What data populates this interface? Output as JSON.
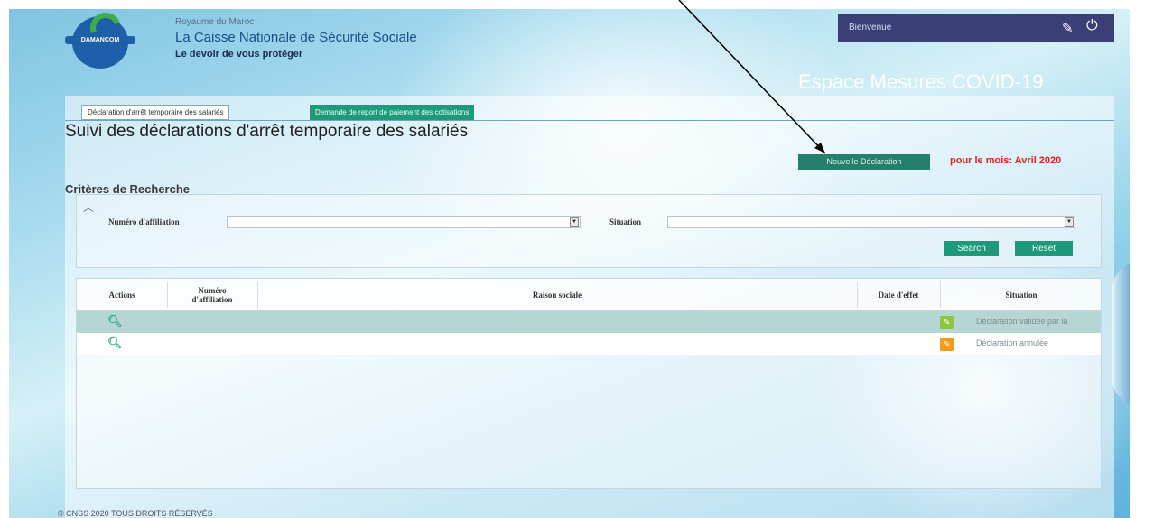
{
  "header": {
    "logo_text": "DAMANCOM",
    "kingdom": "Royaume du Maroc",
    "org_name": "La Caisse Nationale de Sécurité Sociale",
    "tagline": "Le devoir de vous protéger",
    "welcome": "Bienvenue",
    "edit_icon": "pencil-icon",
    "power_icon": "power-icon",
    "space_title": "Espace Mesures COVID-19"
  },
  "tabs": [
    {
      "label": "Déclaration d'arrêt temporaire des salariés",
      "active": true
    },
    {
      "label": "Demande de report de paiement des cotisations",
      "active": false
    }
  ],
  "page_title": "Suivi des déclarations d'arrêt temporaire des salariés",
  "new_declaration_label": "Nouvelle Déclaration",
  "month_label": "pour le mois: Avril 2020",
  "search": {
    "title": "Critères de Recherche",
    "affiliation_label": "Numéro d'affiliation",
    "affiliation_value": "",
    "situation_label": "Situation",
    "situation_value": "",
    "search_button": "Search",
    "reset_button": "Reset"
  },
  "table": {
    "headers": {
      "actions": "Actions",
      "numero_1": "Numéro",
      "numero_2": "d'affiliation",
      "raison": "Raison sociale",
      "date": "Date d'effet",
      "situation": "Situation"
    },
    "rows": [
      {
        "action_icon": "search-icon",
        "numero": "",
        "raison": "",
        "date": "",
        "situation": "Déclaration validée par la",
        "status_color": "#8cc63f"
      },
      {
        "action_icon": "search-icon",
        "numero": "",
        "raison": "",
        "date": "",
        "situation": "Déclaration annulée",
        "status_color": "#f39a1a"
      }
    ]
  },
  "footer": "© CNSS 2020 TOUS DROITS RÉSERVÉS",
  "colors": {
    "accent_green": "#1e9a7a",
    "alert_red": "#e0201c",
    "userbar": "#3b3f78"
  }
}
